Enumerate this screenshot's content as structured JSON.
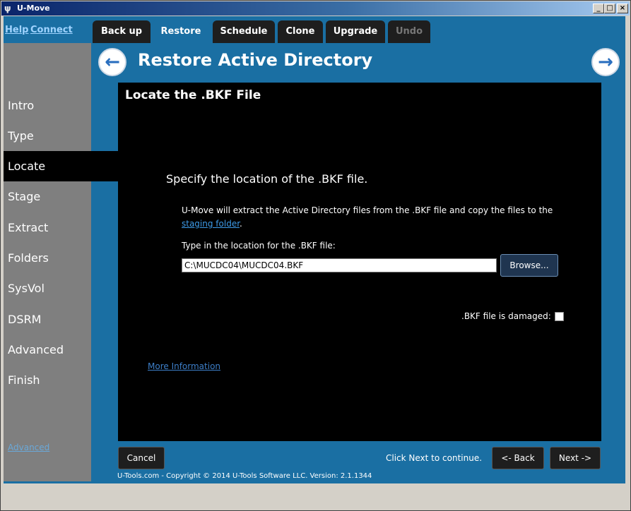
{
  "window": {
    "title": "U-Move",
    "icon": "app-logo-icon",
    "controls": {
      "minimize": "_",
      "maximize": "□",
      "close": "×"
    }
  },
  "header_links": {
    "help": "Help",
    "connect": "Connect"
  },
  "tabs": [
    {
      "label": "Back up",
      "state": "normal"
    },
    {
      "label": "Restore",
      "state": "active"
    },
    {
      "label": "Schedule",
      "state": "normal"
    },
    {
      "label": "Clone",
      "state": "normal"
    },
    {
      "label": "Upgrade",
      "state": "normal"
    },
    {
      "label": "Undo",
      "state": "disabled"
    }
  ],
  "page": {
    "title": "Restore Active Directory",
    "back_icon": "arrow-left-icon",
    "next_icon": "arrow-right-icon"
  },
  "sidebar": {
    "items": [
      "Intro",
      "Type",
      "Locate",
      "Stage",
      "Extract",
      "Folders",
      "SysVol",
      "DSRM",
      "Advanced",
      "Finish"
    ],
    "active": "Locate",
    "bottom_link": "Advanced"
  },
  "panel": {
    "heading": "Locate the .BKF File",
    "specify": "Specify the location of the .BKF file.",
    "description_prefix": "U-Move will extract the Active Directory files from the .BKF file and copy the files to the ",
    "staging_link": "staging folder",
    "description_suffix": ".",
    "type_label": "Type in the location for the .BKF file:",
    "path_value": "C:\\MUCDC04\\MUCDC04.BKF",
    "browse_label": "Browse...",
    "damaged_label": ".BKF file is damaged:",
    "damaged_checked": false,
    "more_info": "More Information"
  },
  "bottom": {
    "cancel": "Cancel",
    "hint": "Click Next to continue.",
    "back": "<- Back",
    "next": "Next ->"
  },
  "footer": "U-Tools.com - Copyright © 2014 U-Tools Software LLC.    Version: 2.1.1344",
  "colors": {
    "accent_blue": "#1a6fa3",
    "sidebar_gray": "#7f7f7f",
    "panel_black": "#000000",
    "link_blue": "#3d9be9"
  }
}
